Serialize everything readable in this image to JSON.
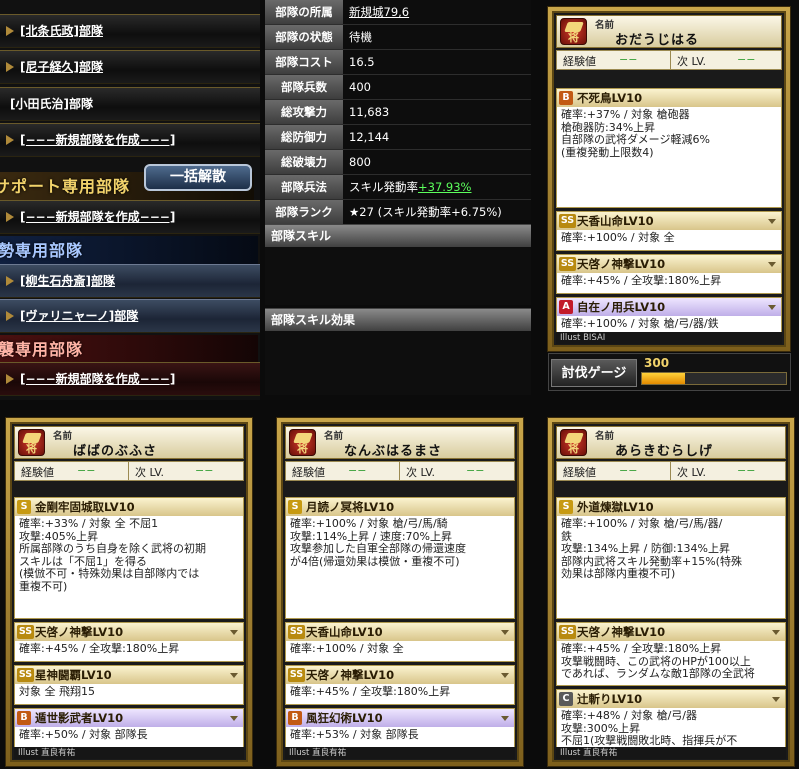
{
  "deck_list": {
    "rows": [
      {
        "label": "[北条氏政]部隊"
      },
      {
        "label": "[尼子経久]部隊"
      },
      {
        "label": "[小田氏治]部隊"
      },
      {
        "label": "[−−−新規部隊を作成−−−]"
      }
    ],
    "support_header": "サポート専用部隊",
    "disband_label": "一括解散",
    "support_rows": [
      {
        "label": "[−−−新規部隊を作成−−−]"
      }
    ],
    "force_header": "勢専用部隊",
    "force_rows": [
      {
        "label": "[柳生石舟斎]部隊"
      },
      {
        "label": "[ヴァリニャーノ]部隊"
      }
    ],
    "raid_header": "襲専用部隊",
    "raid_rows": [
      {
        "label": "[−−−新規部隊を作成−−−]"
      }
    ]
  },
  "stats": {
    "rows": [
      {
        "label": "部隊の所属",
        "value": "新規城79,6"
      },
      {
        "label": "部隊の状態",
        "value": "待機"
      },
      {
        "label": "部隊コスト",
        "value": "16.5"
      },
      {
        "label": "部隊兵数",
        "value": "400"
      },
      {
        "label": "総攻撃力",
        "value": "11,683"
      },
      {
        "label": "総防御力",
        "value": "12,144"
      },
      {
        "label": "総破壊力",
        "value": "800"
      },
      {
        "label": "部隊兵法",
        "value": "スキル発動率",
        "extra": "+37.93%"
      },
      {
        "label": "部隊ランク",
        "value": "★27 (スキル発動率+6.75%)"
      }
    ],
    "skill_title": "部隊スキル",
    "skill_effect_title": "部隊スキル効果"
  },
  "gauge": {
    "label": "討伐ゲージ",
    "value": "300",
    "fill": 0.3
  },
  "cards": [
    {
      "name_label": "名前",
      "name": "おだうじはる",
      "rank_icon": "将",
      "xp_label": "経験値",
      "xp_val": "−−",
      "next_label": "次 LV.",
      "next_val": "−−",
      "illust": "Illust BISAI",
      "skills": [
        {
          "rank": "B",
          "name": "不死鳥LV10",
          "body": "確率:+37% / 対象 槍砲器\n槍砲器防:34%上昇\n自部隊の武将ダメージ軽減6%\n(重複発動上限数4)"
        },
        {
          "rank": "SS",
          "name": "天香山命LV10",
          "body": "確率:+100% / 対象 全"
        },
        {
          "rank": "SS",
          "name": "天啓ノ神撃LV10",
          "body": "確率:+45% / 全攻撃:180%上昇"
        },
        {
          "rank": "A",
          "name": "自在ノ用兵LV10",
          "body": "確率:+100% / 対象 槍/弓/器/鉄"
        }
      ]
    },
    {
      "name_label": "名前",
      "name": "ばばのぶふさ",
      "rank_icon": "将",
      "xp_label": "経験値",
      "xp_val": "−−",
      "next_label": "次 LV.",
      "next_val": "−−",
      "illust": "Illust 直良有祐",
      "skills": [
        {
          "rank": "S",
          "name": "金剛牢固城取LV10",
          "body": "確率:+33% / 対象 全 不屈1\n攻撃:405%上昇\n所属部隊のうち自身を除く武将の初期\nスキルは「不屈1」を得る\n(模倣不可・特殊効果は自部隊内では\n重複不可)"
        },
        {
          "rank": "SS",
          "name": "天啓ノ神撃LV10",
          "body": "確率:+45% / 全攻撃:180%上昇"
        },
        {
          "rank": "SS",
          "name": "星神闘覇LV10",
          "body": "対象 全 飛翔15"
        },
        {
          "rank": "B",
          "name": "遁世影武者LV10",
          "body": "確率:+50% / 対象 部隊長"
        }
      ]
    },
    {
      "name_label": "名前",
      "name": "なんぶはるまさ",
      "rank_icon": "将",
      "xp_label": "経験値",
      "xp_val": "−−",
      "next_label": "次 LV.",
      "next_val": "−−",
      "illust": "Illust 直良有祐",
      "skills": [
        {
          "rank": "S",
          "name": "月読ノ冥将LV10",
          "body": "確率:+100% / 対象 槍/弓/馬/騎\n攻撃:114%上昇 / 速度:70%上昇\n攻撃参加した自軍全部隊の帰還速度\nが4倍(帰還効果は模倣・重複不可)"
        },
        {
          "rank": "SS",
          "name": "天香山命LV10",
          "body": "確率:+100% / 対象 全"
        },
        {
          "rank": "SS",
          "name": "天啓ノ神撃LV10",
          "body": "確率:+45% / 全攻撃:180%上昇"
        },
        {
          "rank": "B",
          "name": "風狂幻術LV10",
          "body": "確率:+53% / 対象 部隊長"
        }
      ]
    },
    {
      "name_label": "名前",
      "name": "あらきむらしげ",
      "rank_icon": "将",
      "xp_label": "経験値",
      "xp_val": "−−",
      "next_label": "次 LV.",
      "next_val": "−−",
      "illust": "Illust 直良有祐",
      "skills": [
        {
          "rank": "S",
          "name": "外道煉獄LV10",
          "body": "確率:+100% / 対象 槍/弓/馬/器/\n鉄\n攻撃:134%上昇 / 防御:134%上昇\n部隊内武将スキル発動率+15%(特殊\n効果は部隊内重複不可)"
        },
        {
          "rank": "SS",
          "name": "天啓ノ神撃LV10",
          "body": "確率:+45% / 全攻撃:180%上昇\n攻撃戦闘時、この武将のHPが100以上\nであれば、ランダムな敵1部隊の全武将"
        },
        {
          "rank": "C",
          "name": "辻斬りLV10",
          "body": "確率:+48% / 対象 槍/弓/器\n攻撃:300%上昇\n不屈1(攻撃戦闘敗北時、指揮兵が不"
        }
      ]
    }
  ]
}
